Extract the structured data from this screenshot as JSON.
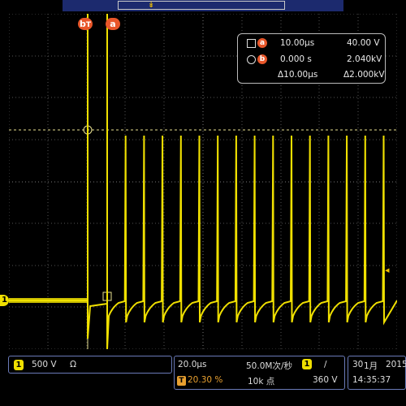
{
  "top": {
    "trigger_glyph": "↡"
  },
  "cursors": {
    "b_label": "b",
    "b_suffix": "T",
    "a_label": "a"
  },
  "readout": {
    "row1": {
      "label": "a",
      "time": "10.00μs",
      "value": "40.00 V"
    },
    "row2": {
      "label": "b",
      "time": "0.000 s",
      "value": "2.040kV"
    },
    "row3": {
      "dtime": "Δ10.00μs",
      "dvalue": "Δ2.000kV"
    }
  },
  "channel": {
    "badge": "1",
    "scale": "500 V",
    "coupling": "Ω"
  },
  "timebase": {
    "per_div": "20.0μs",
    "sample_rate": "50.0M次/秒",
    "trigger_badge": "1",
    "slope": "/",
    "t_badge": "T",
    "position": "20.30 %",
    "record": "10k 点",
    "trig_level": "360 V"
  },
  "clock": {
    "date_day": "30",
    "date_month": "1月",
    "year": "2015",
    "time": "14:35:37"
  },
  "markers": {
    "ch1": "1",
    "right_arrow": "◂"
  },
  "colors": {
    "trace": "#f0e000",
    "cursor": "#e8562a",
    "grid": "#555555",
    "panel_border": "#6a7ab8"
  }
}
